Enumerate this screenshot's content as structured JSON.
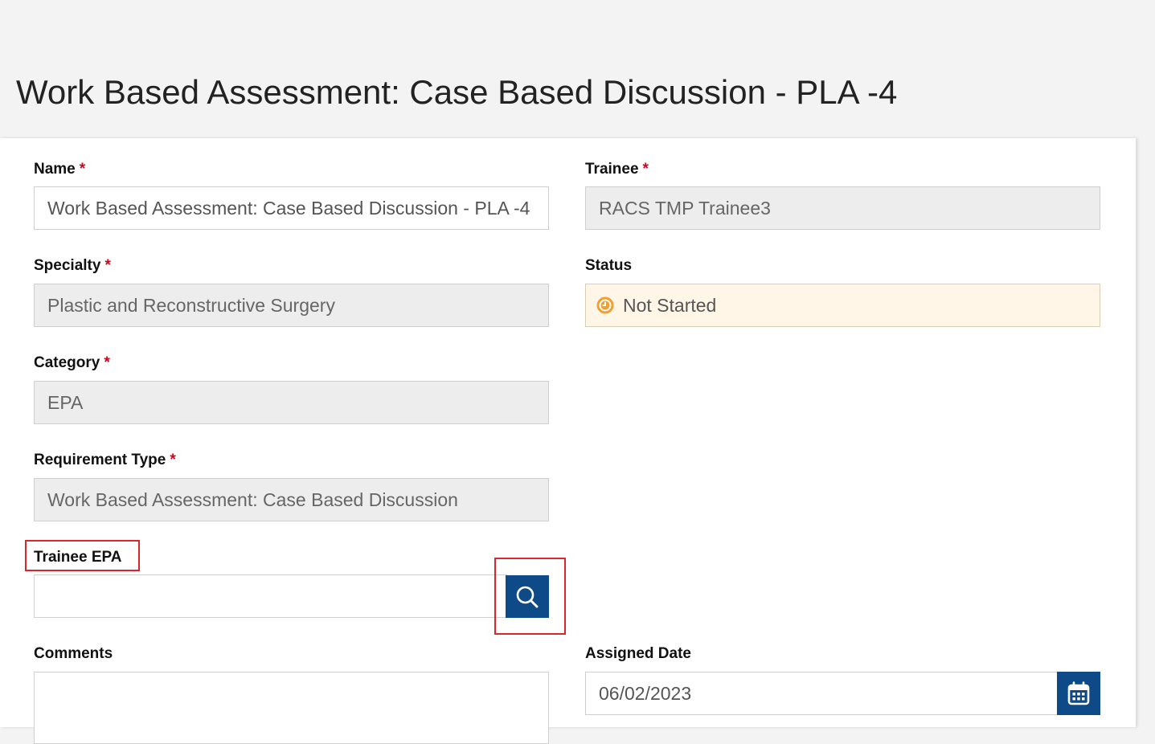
{
  "page": {
    "title": "Work Based Assessment: Case Based Discussion - PLA -4"
  },
  "form": {
    "required_marker": "*",
    "name": {
      "label": "Name",
      "value": "Work Based Assessment: Case Based Discussion - PLA -4"
    },
    "trainee": {
      "label": "Trainee",
      "value": "RACS TMP Trainee3"
    },
    "specialty": {
      "label": "Specialty",
      "value": "Plastic and Reconstructive Surgery"
    },
    "status": {
      "label": "Status",
      "value": "Not Started",
      "icon": "clock-icon",
      "icon_color": "#f0a030"
    },
    "category": {
      "label": "Category",
      "value": "EPA"
    },
    "requirement_type": {
      "label": "Requirement Type",
      "value": "Work Based Assessment: Case Based Discussion"
    },
    "trainee_epa": {
      "label": "Trainee EPA",
      "value": "",
      "search_icon": "search-icon"
    },
    "comments": {
      "label": "Comments",
      "value": ""
    },
    "assigned_date": {
      "label": "Assigned Date",
      "value": "06/02/2023",
      "calendar_icon": "calendar-icon"
    }
  },
  "colors": {
    "accent": "#0d4a87",
    "required": "#d0021b",
    "highlight": "#d9262a",
    "status_bg": "#fff6e8"
  }
}
